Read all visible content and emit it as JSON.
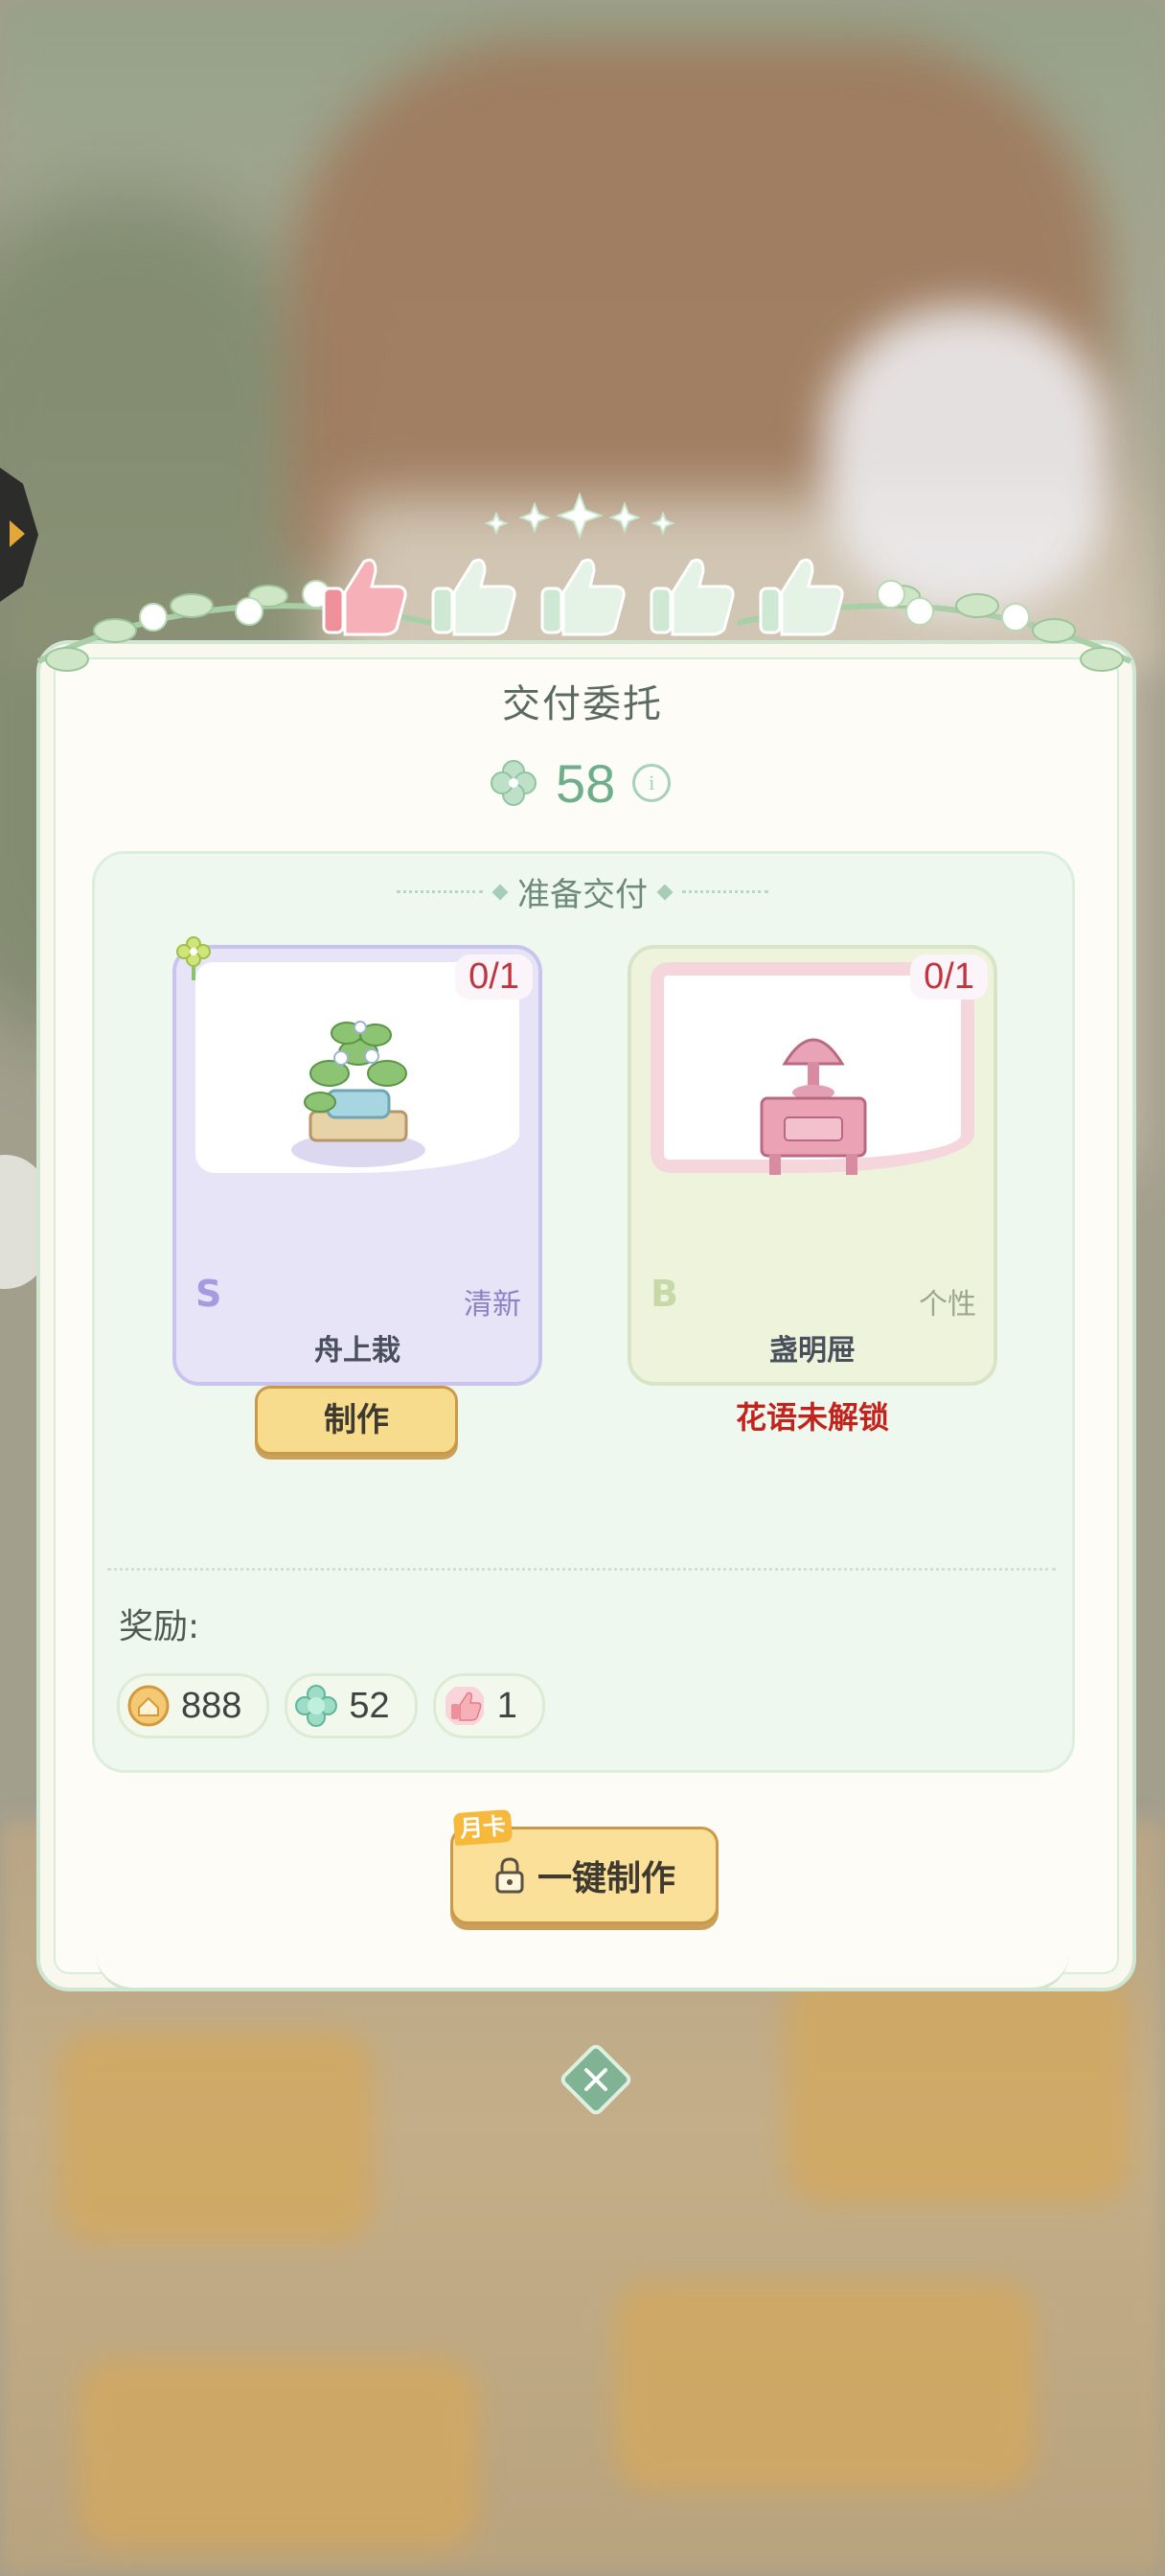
{
  "colors": {
    "accent_green": "#6fae8b",
    "locked_red": "#c3231d",
    "button_yellow": "#f8dc8e",
    "like_pink": "#ef8f9a"
  },
  "header": {
    "title": "交付委托",
    "score": "58",
    "score_icon": "clover-icon",
    "info_icon": "info-icon",
    "likes": {
      "filled": 1,
      "total": 5
    }
  },
  "deliver": {
    "section_title": "准备交付",
    "items": [
      {
        "name": "舟上栽",
        "count": "0/1",
        "rank": "S",
        "style": "清新",
        "action_label": "制作",
        "state": "craftable"
      },
      {
        "name": "盏明屉",
        "count": "0/1",
        "rank": "B",
        "style": "个性",
        "status_text": "花语未解锁",
        "state": "locked"
      }
    ]
  },
  "rewards": {
    "label": "奖励:",
    "items": [
      {
        "icon": "coin-icon",
        "value": "888"
      },
      {
        "icon": "exp-icon",
        "value": "52"
      },
      {
        "icon": "thumbs-up-icon",
        "value": "1"
      }
    ]
  },
  "one_key": {
    "tag": "月卡",
    "label": "一键制作",
    "icon": "lock-icon"
  }
}
